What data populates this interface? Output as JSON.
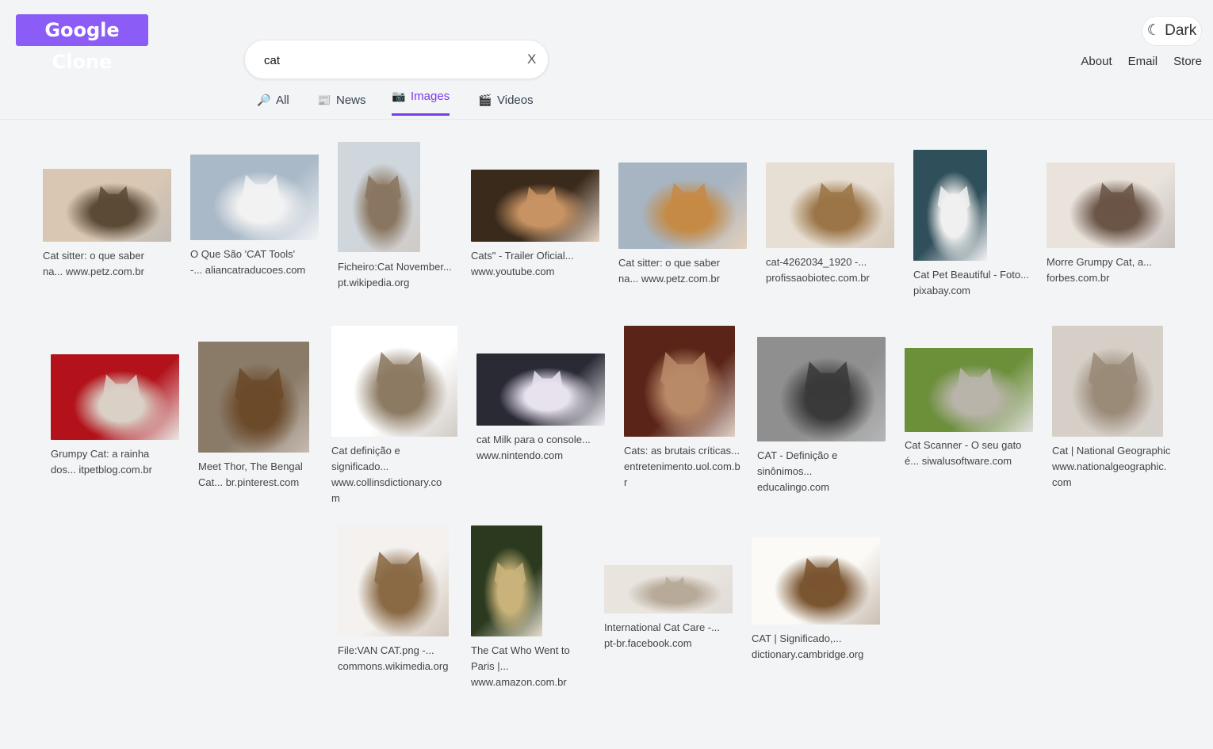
{
  "app": {
    "logo": "Google Clone"
  },
  "search": {
    "value": "cat",
    "clear_label": "X"
  },
  "theme_toggle": {
    "label": "☾ Dark"
  },
  "nav": {
    "about": "About",
    "email": "Email",
    "store": "Store"
  },
  "tabs": [
    {
      "icon": "🔎",
      "label": "All"
    },
    {
      "icon": "📰",
      "label": "News"
    },
    {
      "icon": "📷",
      "label": "Images",
      "active": true
    },
    {
      "icon": "🎬",
      "label": "Videos"
    }
  ],
  "results": [
    {
      "title": "Cat sitter: o que saber na...",
      "site": "www.petz.com.br",
      "colors": [
        "#d9c7b3",
        "#5b4a36"
      ]
    },
    {
      "title": "O Que São 'CAT Tools' -...",
      "site": "aliancatraducoes.com",
      "colors": [
        "#a9b9c8",
        "#f2f2f2"
      ]
    },
    {
      "title": "Ficheiro:Cat November...",
      "site": "pt.wikipedia.org",
      "colors": [
        "#cfd6dc",
        "#8a7660"
      ]
    },
    {
      "title": "Cats\" - Trailer Oficial...",
      "site": "www.youtube.com",
      "colors": [
        "#3a2a1c",
        "#c79363"
      ]
    },
    {
      "title": "Cat sitter: o que saber na...",
      "site": "www.petz.com.br",
      "colors": [
        "#a7b4c2",
        "#c58a45"
      ]
    },
    {
      "title": "cat-4262034_1920 -...",
      "site": "profissaobiotec.com.br",
      "colors": [
        "#e7dfd4",
        "#9b7547"
      ]
    },
    {
      "title": "Cat Pet Beautiful - Foto...",
      "site": "pixabay.com",
      "colors": [
        "#2f4f5a",
        "#f0f0f0"
      ]
    },
    {
      "title": "Morre Grumpy Cat, a...",
      "site": "forbes.com.br",
      "colors": [
        "#e9e3dc",
        "#6b5547"
      ]
    },
    {
      "title": "Grumpy Cat: a rainha dos...",
      "site": "itpetblog.com.br",
      "colors": [
        "#b3121a",
        "#d9d0c6"
      ]
    },
    {
      "title": "Meet Thor, The Bengal Cat...",
      "site": "br.pinterest.com",
      "colors": [
        "#8a7a68",
        "#6b4a2a"
      ]
    },
    {
      "title": "Cat definição e significado...",
      "site": "www.collinsdictionary.com",
      "colors": [
        "#ffffff",
        "#8c7a63"
      ]
    },
    {
      "title": "cat Milk para o console...",
      "site": "www.nintendo.com",
      "colors": [
        "#2a2a35",
        "#e7e2ee"
      ]
    },
    {
      "title": "Cats: as brutais críticas...",
      "site": "entretenimento.uol.com.br",
      "colors": [
        "#5a2418",
        "#b98a68"
      ]
    },
    {
      "title": "CAT - Definição e sinônimos...",
      "site": "educalingo.com",
      "colors": [
        "#8f8f8f",
        "#3a3a3a"
      ]
    },
    {
      "title": "Cat Scanner - O seu gato é...",
      "site": "siwalusoftware.com",
      "colors": [
        "#6c8f3a",
        "#b9b4aa"
      ]
    },
    {
      "title": "Cat | National Geographic",
      "site": "www.nationalgeographic.com",
      "colors": [
        "#d5cfc7",
        "#9a8a78"
      ]
    },
    {
      "title": "File:VAN CAT.png -...",
      "site": "commons.wikimedia.org",
      "colors": [
        "#f4f1ee",
        "#8a6a45"
      ]
    },
    {
      "title": "The Cat Who Went to Paris |...",
      "site": "www.amazon.com.br",
      "colors": [
        "#2b3a1e",
        "#c9b37a"
      ]
    },
    {
      "title": "International Cat Care -...",
      "site": "pt-br.facebook.com",
      "colors": [
        "#e9e4de",
        "#b7aa98"
      ]
    },
    {
      "title": "CAT | Significado,...",
      "site": "dictionary.cambridge.org",
      "colors": [
        "#fbfaf7",
        "#7a5530"
      ]
    }
  ]
}
